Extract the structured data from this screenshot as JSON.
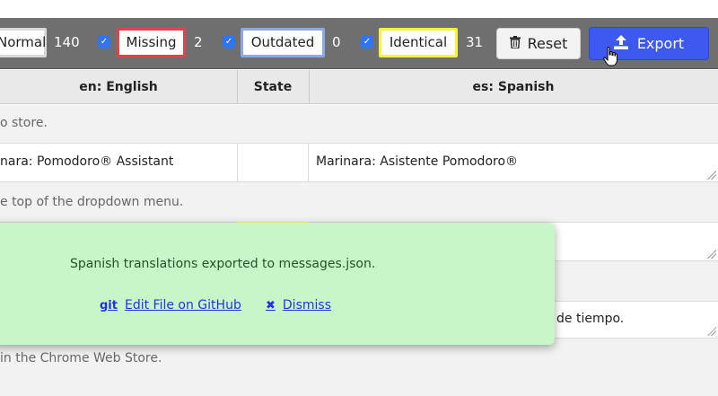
{
  "toolbar": {
    "filters": [
      {
        "label": "Normal",
        "count": "140",
        "border": "#d9d9d9"
      },
      {
        "label": "Missing",
        "count": "2",
        "border": "#e0434e",
        "checked": true
      },
      {
        "label": "Outdated",
        "count": "0",
        "border": "#8aa9e6",
        "checked": true
      },
      {
        "label": "Identical",
        "count": "31",
        "border": "#f4f43c",
        "checked": true
      }
    ],
    "reset_label": "Reset",
    "export_label": "Export"
  },
  "table": {
    "headers": {
      "en": "en: English",
      "state": "State",
      "es": "es: Spanish"
    },
    "rows": [
      {
        "desc": "o store."
      },
      {
        "en": "nara: Pomodoro® Assistant",
        "es": "Marinara: Asistente Pomodoro®"
      },
      {
        "desc": "e top of the dropdown menu."
      },
      {
        "es_partial": "de tiempo."
      },
      {
        "desc": "in the Chrome Web Store."
      }
    ]
  },
  "toast": {
    "message": "Spanish translations exported to messages.json.",
    "git_icon": "git",
    "git_link": "Edit File on GitHub",
    "dismiss_icon": "✖",
    "dismiss_link": "Dismiss",
    "background": "#c9f6c9"
  },
  "colors": {
    "toolbar": "#6f6f6f",
    "export_button": "#3d59f0",
    "link": "#2233dd"
  }
}
